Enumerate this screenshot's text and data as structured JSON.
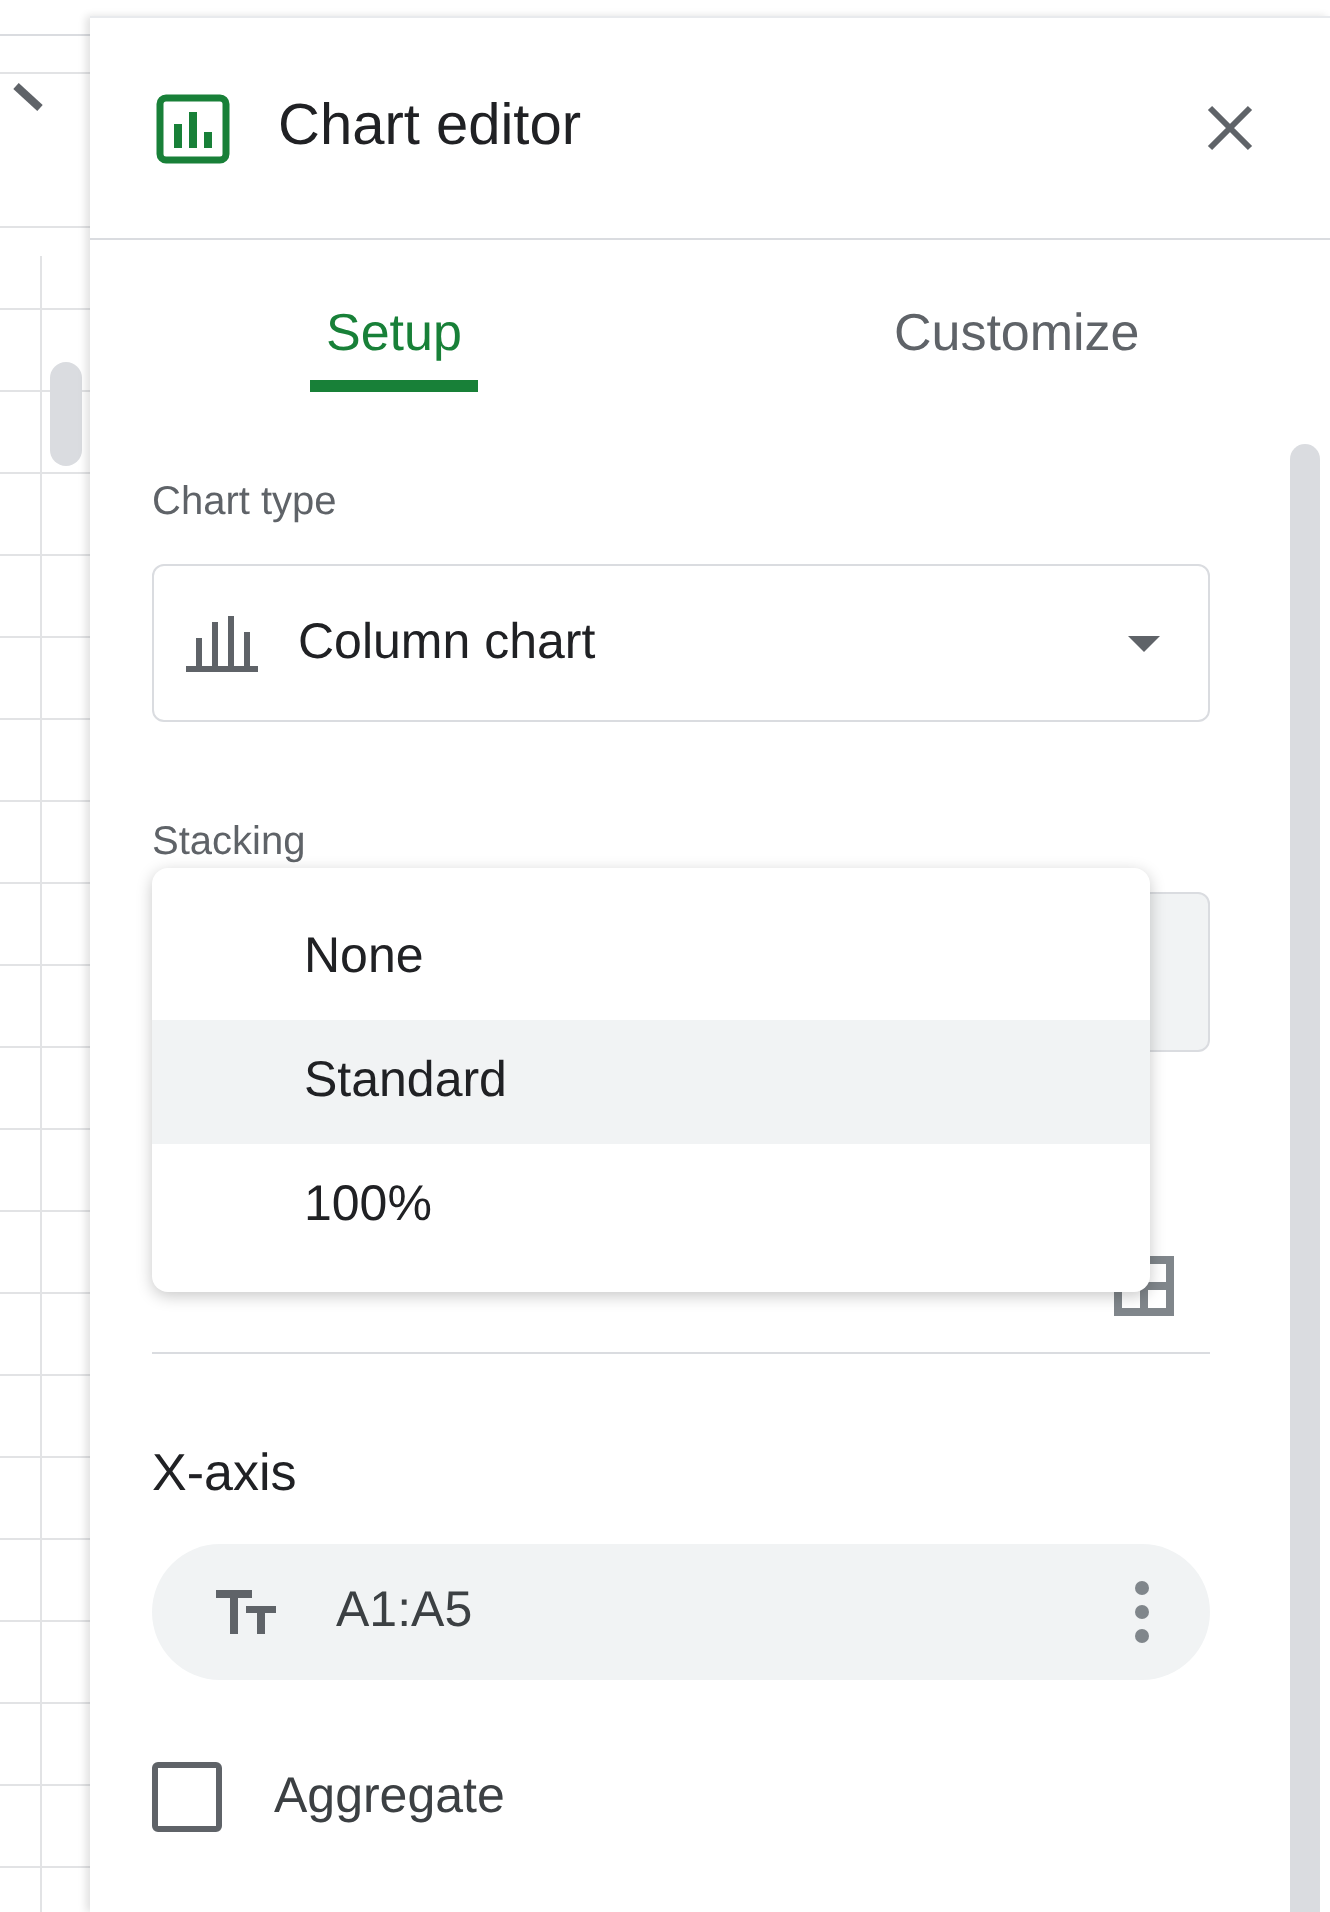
{
  "header": {
    "title": "Chart editor"
  },
  "tabs": [
    {
      "label": "Setup",
      "selected": true
    },
    {
      "label": "Customize",
      "selected": false
    }
  ],
  "chart_type": {
    "label": "Chart type",
    "value": "Column chart"
  },
  "stacking": {
    "label": "Stacking",
    "menu": [
      {
        "label": "None",
        "selected": false
      },
      {
        "label": "Standard",
        "selected": true
      },
      {
        "label": "100%",
        "selected": false
      }
    ]
  },
  "x_axis": {
    "label": "X-axis",
    "range": "A1:A5"
  },
  "aggregate": {
    "label": "Aggregate",
    "checked": false
  }
}
